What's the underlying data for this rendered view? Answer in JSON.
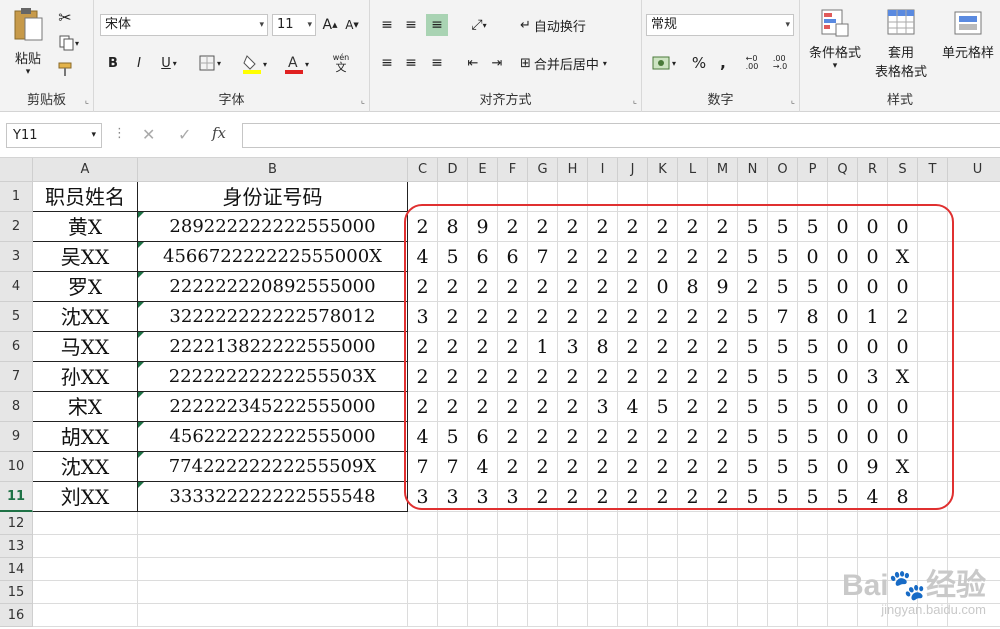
{
  "ribbon": {
    "clipboard": {
      "label": "剪贴板",
      "paste": "粘贴"
    },
    "font": {
      "label": "字体",
      "name": "宋体",
      "size": "11",
      "bold": "B",
      "italic": "I",
      "underline": "U",
      "phonetic": "wén",
      "grow": "A",
      "shrink": "A"
    },
    "alignment": {
      "label": "对齐方式",
      "wrap": "自动换行",
      "merge": "合并后居中"
    },
    "number": {
      "label": "数字",
      "format": "常规",
      "percent": "%",
      "comma": ","
    },
    "styles": {
      "label": "样式",
      "conditional": "条件格式",
      "table_1": "套用",
      "table_2": "表格格式",
      "cell_styles": "单元格样"
    }
  },
  "formula_bar": {
    "name_box": "Y11",
    "fx": "fx",
    "cancel": "✕",
    "enter": "✓",
    "dots": "⋮",
    "value": ""
  },
  "columns": [
    "A",
    "B",
    "C",
    "D",
    "E",
    "F",
    "G",
    "H",
    "I",
    "J",
    "K",
    "L",
    "M",
    "N",
    "O",
    "P",
    "Q",
    "R",
    "S",
    "T",
    "U"
  ],
  "rows": [
    "1",
    "2",
    "3",
    "4",
    "5",
    "6",
    "7",
    "8",
    "9",
    "10",
    "11",
    "12",
    "13",
    "14",
    "15",
    "16"
  ],
  "table": {
    "headers": [
      "职员姓名",
      "身份证号码"
    ],
    "records": [
      {
        "name": "黄X",
        "id": "289222222222555000",
        "digits": [
          "2",
          "8",
          "9",
          "2",
          "2",
          "2",
          "2",
          "2",
          "2",
          "2",
          "2",
          "5",
          "5",
          "5",
          "0",
          "0",
          "0"
        ]
      },
      {
        "name": "吴XX",
        "id": "456672222222555000X",
        "digits": [
          "4",
          "5",
          "6",
          "6",
          "7",
          "2",
          "2",
          "2",
          "2",
          "2",
          "2",
          "5",
          "5",
          "0",
          "0",
          "0",
          "X"
        ]
      },
      {
        "name": "罗X",
        "id": "222222220892555000",
        "digits": [
          "2",
          "2",
          "2",
          "2",
          "2",
          "2",
          "2",
          "2",
          "0",
          "8",
          "9",
          "2",
          "5",
          "5",
          "0",
          "0",
          "0"
        ]
      },
      {
        "name": "沈XX",
        "id": "322222222222578012",
        "digits": [
          "3",
          "2",
          "2",
          "2",
          "2",
          "2",
          "2",
          "2",
          "2",
          "2",
          "2",
          "5",
          "7",
          "8",
          "0",
          "1",
          "2"
        ]
      },
      {
        "name": "马XX",
        "id": "222213822222555000",
        "digits": [
          "2",
          "2",
          "2",
          "2",
          "1",
          "3",
          "8",
          "2",
          "2",
          "2",
          "2",
          "5",
          "5",
          "5",
          "0",
          "0",
          "0"
        ]
      },
      {
        "name": "孙XX",
        "id": "22222222222255503X",
        "digits": [
          "2",
          "2",
          "2",
          "2",
          "2",
          "2",
          "2",
          "2",
          "2",
          "2",
          "2",
          "5",
          "5",
          "5",
          "0",
          "3",
          "X"
        ]
      },
      {
        "name": "宋X",
        "id": "222222345222555000",
        "digits": [
          "2",
          "2",
          "2",
          "2",
          "2",
          "2",
          "3",
          "4",
          "5",
          "2",
          "2",
          "5",
          "5",
          "5",
          "0",
          "0",
          "0"
        ]
      },
      {
        "name": "胡XX",
        "id": "456222222222555000",
        "digits": [
          "4",
          "5",
          "6",
          "2",
          "2",
          "2",
          "2",
          "2",
          "2",
          "2",
          "2",
          "5",
          "5",
          "5",
          "0",
          "0",
          "0"
        ]
      },
      {
        "name": "沈XX",
        "id": "77422222222255509X",
        "digits": [
          "7",
          "7",
          "4",
          "2",
          "2",
          "2",
          "2",
          "2",
          "2",
          "2",
          "2",
          "5",
          "5",
          "5",
          "0",
          "9",
          "X"
        ]
      },
      {
        "name": "刘XX",
        "id": "333322222222555548",
        "digits": [
          "3",
          "3",
          "3",
          "3",
          "2",
          "2",
          "2",
          "2",
          "2",
          "2",
          "2",
          "5",
          "5",
          "5",
          "5",
          "4",
          "8"
        ]
      }
    ]
  },
  "watermark": {
    "brand": "Bai",
    "brand_cn": "经验",
    "url": "jingyan.baidu.com"
  }
}
